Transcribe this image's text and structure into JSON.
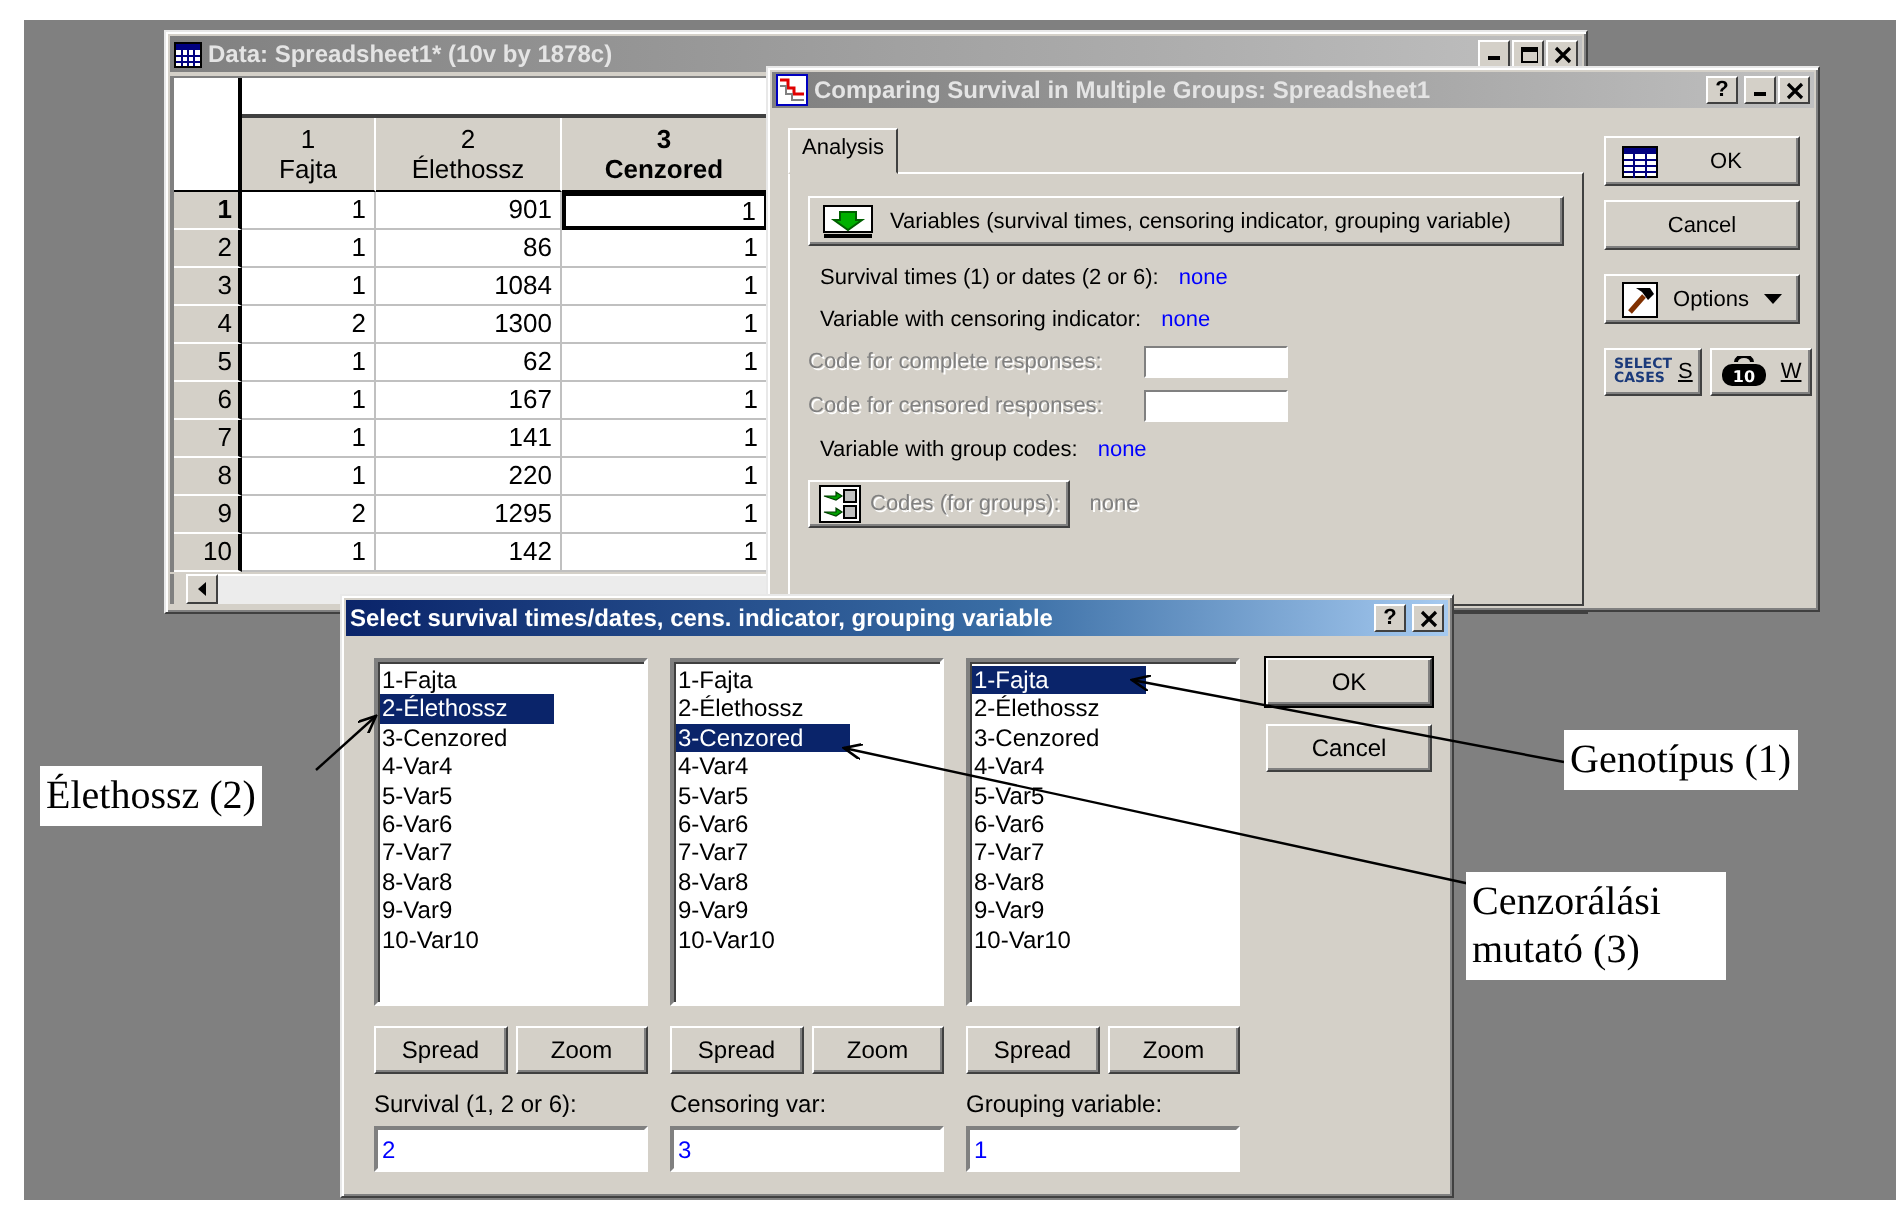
{
  "spreadsheet_window": {
    "title": "Data: Spreadsheet1* (10v by 1878c)",
    "columns": [
      {
        "number": "1",
        "name": "Fajta",
        "current": false
      },
      {
        "number": "2",
        "name": "Élethossz",
        "current": false
      },
      {
        "number": "3",
        "name": "Cenzored",
        "current": true
      }
    ],
    "rows": [
      {
        "number": "1",
        "cells": [
          "1",
          "901",
          "1"
        ],
        "current": true
      },
      {
        "number": "2",
        "cells": [
          "1",
          "86",
          "1"
        ],
        "current": false
      },
      {
        "number": "3",
        "cells": [
          "1",
          "1084",
          "1"
        ],
        "current": false
      },
      {
        "number": "4",
        "cells": [
          "2",
          "1300",
          "1"
        ],
        "current": false
      },
      {
        "number": "5",
        "cells": [
          "1",
          "62",
          "1"
        ],
        "current": false
      },
      {
        "number": "6",
        "cells": [
          "1",
          "167",
          "1"
        ],
        "current": false
      },
      {
        "number": "7",
        "cells": [
          "1",
          "141",
          "1"
        ],
        "current": false
      },
      {
        "number": "8",
        "cells": [
          "1",
          "220",
          "1"
        ],
        "current": false
      },
      {
        "number": "9",
        "cells": [
          "2",
          "1295",
          "1"
        ],
        "current": false
      },
      {
        "number": "10",
        "cells": [
          "1",
          "142",
          "1"
        ],
        "current": false
      }
    ]
  },
  "survival_dialog": {
    "title": "Comparing Survival in Multiple Groups: Spreadsheet1",
    "help_button": "?",
    "tabs": [
      {
        "label": "Analysis",
        "selected": true
      }
    ],
    "variables_button": "Variables (survival times, censoring indicator, grouping variable)",
    "rows": [
      {
        "kind": "value",
        "label": "Survival times (1) or dates (2 or 6):",
        "value": "none",
        "disabled": false
      },
      {
        "kind": "value",
        "label": "Variable with censoring indicator:",
        "value": "none",
        "disabled": false
      },
      {
        "kind": "input",
        "label": "Code for complete responses:",
        "disabled": true
      },
      {
        "kind": "input",
        "label": "Code for censored responses:",
        "disabled": true
      },
      {
        "kind": "value",
        "label": "Variable with group codes:",
        "value": "none",
        "disabled": false
      },
      {
        "kind": "button",
        "label": "Codes (for groups):",
        "value": "none",
        "disabled": true
      }
    ],
    "ok_button": "OK",
    "cancel_button": "Cancel",
    "options_button": "Options",
    "select_cases_icon_text": "SELECT CASES",
    "select_cases_key": "S",
    "weight_icon_text": "10",
    "weight_key": "W"
  },
  "select_dialog": {
    "title": "Select survival times/dates, cens. indicator, grouping variable",
    "help_button": "?",
    "lists": [
      {
        "items": [
          {
            "label": "1-Fajta",
            "selected": false
          },
          {
            "label": "2-Élethossz",
            "selected": true
          },
          {
            "label": "3-Cenzored",
            "selected": false
          },
          {
            "label": "4-Var4",
            "selected": false
          },
          {
            "label": "5-Var5",
            "selected": false
          },
          {
            "label": "6-Var6",
            "selected": false
          },
          {
            "label": "7-Var7",
            "selected": false
          },
          {
            "label": "8-Var8",
            "selected": false
          },
          {
            "label": "9-Var9",
            "selected": false
          },
          {
            "label": "10-Var10",
            "selected": false
          }
        ],
        "buttons": [
          "Spread",
          "Zoom"
        ],
        "field_label": "Survival (1, 2 or 6):",
        "value": "2"
      },
      {
        "items": [
          {
            "label": "1-Fajta",
            "selected": false
          },
          {
            "label": "2-Élethossz",
            "selected": false
          },
          {
            "label": "3-Cenzored",
            "selected": true
          },
          {
            "label": "4-Var4",
            "selected": false
          },
          {
            "label": "5-Var5",
            "selected": false
          },
          {
            "label": "6-Var6",
            "selected": false
          },
          {
            "label": "7-Var7",
            "selected": false
          },
          {
            "label": "8-Var8",
            "selected": false
          },
          {
            "label": "9-Var9",
            "selected": false
          },
          {
            "label": "10-Var10",
            "selected": false
          }
        ],
        "buttons": [
          "Spread",
          "Zoom"
        ],
        "field_label": "Censoring var:",
        "value": "3"
      },
      {
        "items": [
          {
            "label": "1-Fajta",
            "selected": true
          },
          {
            "label": "2-Élethossz",
            "selected": false
          },
          {
            "label": "3-Cenzored",
            "selected": false
          },
          {
            "label": "4-Var4",
            "selected": false
          },
          {
            "label": "5-Var5",
            "selected": false
          },
          {
            "label": "6-Var6",
            "selected": false
          },
          {
            "label": "7-Var7",
            "selected": false
          },
          {
            "label": "8-Var8",
            "selected": false
          },
          {
            "label": "9-Var9",
            "selected": false
          },
          {
            "label": "10-Var10",
            "selected": false
          }
        ],
        "buttons": [
          "Spread",
          "Zoom"
        ],
        "field_label": "Grouping variable:",
        "value": "1"
      }
    ],
    "ok_button": "OK",
    "cancel_button": "Cancel"
  },
  "annotations": [
    {
      "text": "Élethossz (2)"
    },
    {
      "text": "Genotípus (1)"
    },
    {
      "text": "Cenzorálási mutató (3)"
    }
  ]
}
